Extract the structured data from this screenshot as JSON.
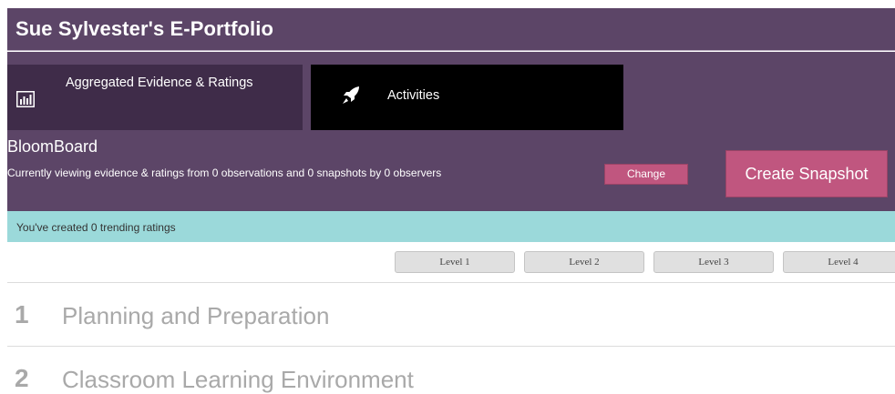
{
  "header": {
    "title": "Sue Sylvester's E-Portfolio"
  },
  "tabs": [
    {
      "label": "Aggregated Evidence & Ratings",
      "icon": "bar-chart-icon"
    },
    {
      "label": "Activities",
      "icon": "rocket-icon"
    }
  ],
  "bloomboard": {
    "title": "BloomBoard",
    "description": "Currently viewing evidence & ratings from 0 observations and 0 snapshots by 0 observers",
    "change_label": "Change",
    "snapshot_label": "Create Snapshot"
  },
  "banner": {
    "text": "You've created 0 trending ratings"
  },
  "levels": [
    "Level 1",
    "Level 2",
    "Level 3",
    "Level 4"
  ],
  "domains": [
    {
      "number": "1",
      "name": "Planning and Preparation"
    },
    {
      "number": "2",
      "name": "Classroom Learning Environment"
    }
  ],
  "colors": {
    "header_bg": "#5c4567",
    "active_tab_bg": "#3f2c49",
    "activities_tab_bg": "#000000",
    "button_pink": "#c0567f",
    "banner_teal": "#9bd9da",
    "domain_gray": "#a9a9a9"
  }
}
